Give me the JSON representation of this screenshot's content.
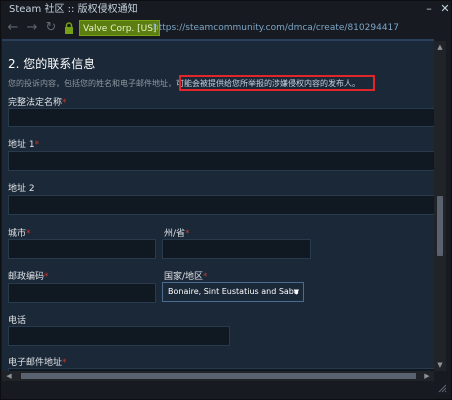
{
  "window": {
    "title": "Steam 社区 :: 版权侵权通知",
    "minimize_glyph": "–",
    "close_glyph": "✕"
  },
  "navbar": {
    "back_icon": "back-arrow-icon",
    "forward_icon": "forward-arrow-icon",
    "refresh_icon": "refresh-icon",
    "cert_label": "Valve Corp. [US]",
    "url": "https://steamcommunity.com/dmca/create/810294417"
  },
  "section": {
    "heading": "2. 您的联系信息",
    "desc_prefix": "您的投诉内容，包括您的姓名和电子邮件地址，",
    "desc_highlight": "可能会被提供给您所举报的涉嫌侵权内容的发布人。"
  },
  "form": {
    "full_name_label": "完整法定名称",
    "address1_label": "地址 1",
    "address2_label": "地址 2",
    "city_label": "城市",
    "state_label": "州/省",
    "postal_label": "邮政编码",
    "country_label": "国家/地区",
    "country_value": "Bonaire, Sint Eustatius and Saba",
    "phone_label": "电话",
    "email_label": "电子邮件地址",
    "required_mark": "*"
  },
  "colors": {
    "accent_red": "#e1262b",
    "cert_green": "#5c7e10",
    "link_blue": "#7ba6c8"
  }
}
